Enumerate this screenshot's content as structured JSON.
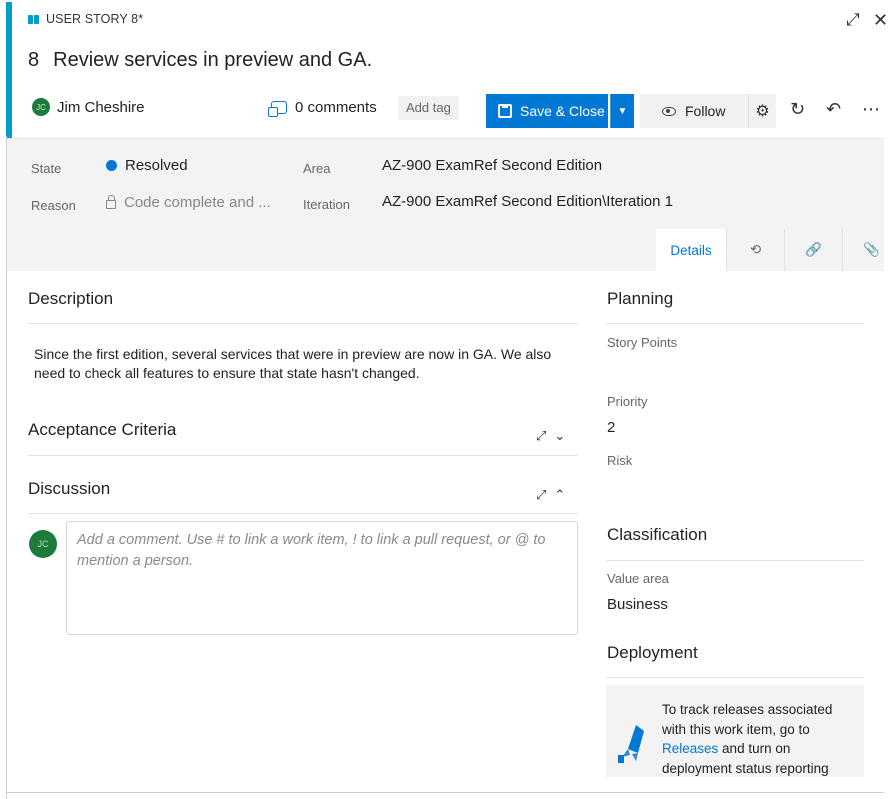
{
  "header": {
    "type_label": "USER STORY 8*",
    "id": "8",
    "title": "Review services in preview and GA.",
    "assignee": "Jim Cheshire",
    "assignee_initials": "JC",
    "comments": "0 comments",
    "add_tag": "Add tag",
    "save_close": "Save & Close",
    "follow": "Follow",
    "icons": [
      "expand-icon",
      "close-icon",
      "gear-icon",
      "refresh-icon",
      "undo-icon",
      "more-icon"
    ]
  },
  "fields": {
    "state_label": "State",
    "state_value": "Resolved",
    "reason_label": "Reason",
    "reason_value": "Code complete and ...",
    "area_label": "Area",
    "area_value": "AZ-900 ExamRef Second Edition",
    "iteration_label": "Iteration",
    "iteration_value": "AZ-900 ExamRef Second Edition\\Iteration 1"
  },
  "tabs": [
    {
      "label": "Details",
      "active": true
    },
    {
      "icon": "history-icon"
    },
    {
      "icon": "link-icon"
    },
    {
      "icon": "attachment-icon"
    }
  ],
  "description": {
    "title": "Description",
    "text": "Since the first edition, several services that were in preview are now in GA. We also need to check all features to ensure that state hasn't changed."
  },
  "acceptance": {
    "title": "Acceptance Criteria"
  },
  "discussion": {
    "title": "Discussion",
    "placeholder": "Add a comment. Use # to link a work item, ! to link a pull request, or @ to mention a person."
  },
  "planning": {
    "title": "Planning",
    "story_points_label": "Story Points",
    "priority_label": "Priority",
    "priority_value": "2",
    "risk_label": "Risk"
  },
  "classification": {
    "title": "Classification",
    "value_area_label": "Value area",
    "value_area_value": "Business"
  },
  "deployment": {
    "title": "Deployment",
    "text_before": "To track releases associated with this work item, go to",
    "link": "Releases",
    "text_after": "and turn on deployment status reporting"
  },
  "colors": {
    "accent": "#009ccc",
    "primary": "#0078d4",
    "avatar": "#1e7c3a"
  }
}
